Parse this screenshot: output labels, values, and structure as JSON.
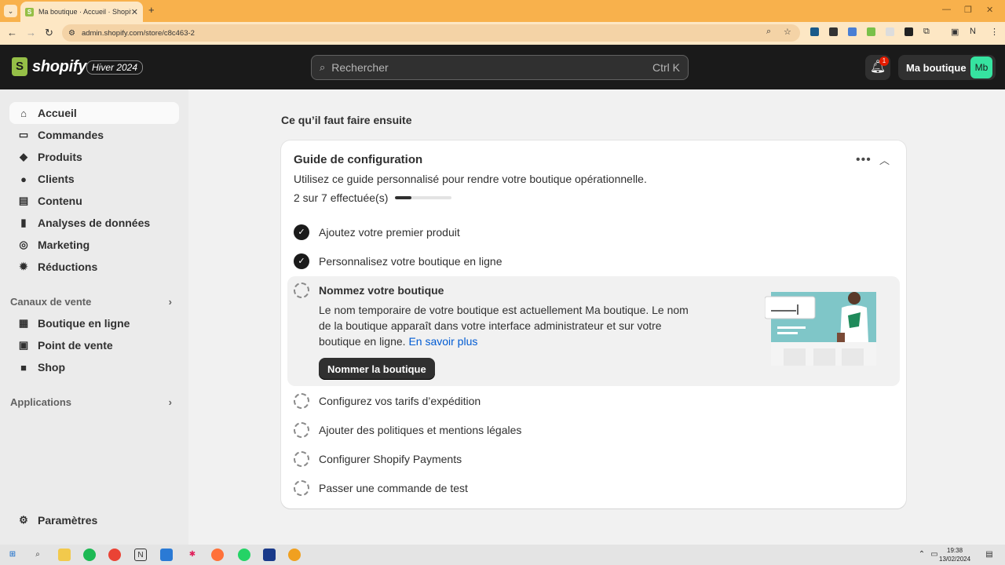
{
  "browser": {
    "tab_title": "Ma boutique · Accueil · Shopify",
    "tab_favicon": "S",
    "url": "admin.shopify.com/store/c8c463-2"
  },
  "topbar": {
    "logo_text": "shopify",
    "edition": "Hiver 2024",
    "search_placeholder": "Rechercher",
    "search_shortcut": "Ctrl K",
    "notifications_count": "1",
    "store_name": "Ma boutique",
    "avatar_initials": "Mb"
  },
  "sidebar": {
    "items": [
      {
        "label": "Accueil",
        "icon": "home-icon"
      },
      {
        "label": "Commandes",
        "icon": "inbox-icon"
      },
      {
        "label": "Produits",
        "icon": "tag-icon"
      },
      {
        "label": "Clients",
        "icon": "person-icon"
      },
      {
        "label": "Contenu",
        "icon": "content-icon"
      },
      {
        "label": "Analyses de données",
        "icon": "chart-icon"
      },
      {
        "label": "Marketing",
        "icon": "target-icon"
      },
      {
        "label": "Réductions",
        "icon": "discount-icon"
      }
    ],
    "sales_channels_label": "Canaux de vente",
    "channels": [
      {
        "label": "Boutique en ligne",
        "icon": "store-icon"
      },
      {
        "label": "Point de vente",
        "icon": "pos-icon"
      },
      {
        "label": "Shop",
        "icon": "shop-icon"
      }
    ],
    "apps_label": "Applications",
    "settings_label": "Paramètres"
  },
  "main": {
    "heading": "Ce qu’il faut faire ensuite",
    "guide": {
      "title": "Guide de configuration",
      "subtitle": "Utilisez ce guide personnalisé pour rendre votre boutique opérationnelle.",
      "progress_text": "2 sur 7 effectuée(s)",
      "progress_fraction": 0.2857,
      "tasks_done": [
        "Ajoutez votre premier produit",
        "Personnalisez votre boutique en ligne"
      ],
      "expanded": {
        "title": "Nommez votre boutique",
        "description": "Le nom temporaire de votre boutique est actuellement Ma boutique. Le nom de la boutique apparaît dans votre interface administrateur et sur votre boutique en ligne.",
        "link": "En savoir plus",
        "button": "Nommer la boutique"
      },
      "tasks_todo": [
        "Configurez vos tarifs d’expédition",
        "Ajouter des politiques et mentions légales",
        "Configurer Shopify Payments",
        "Passer une commande de test"
      ]
    }
  },
  "taskbar": {
    "time": "19:38",
    "date": "13/02/2024"
  },
  "colors": {
    "accent_browser": "#f8b14c",
    "shopify_green": "#95bf47",
    "avatar_green": "#36e3a0",
    "link_blue": "#005bd3"
  }
}
